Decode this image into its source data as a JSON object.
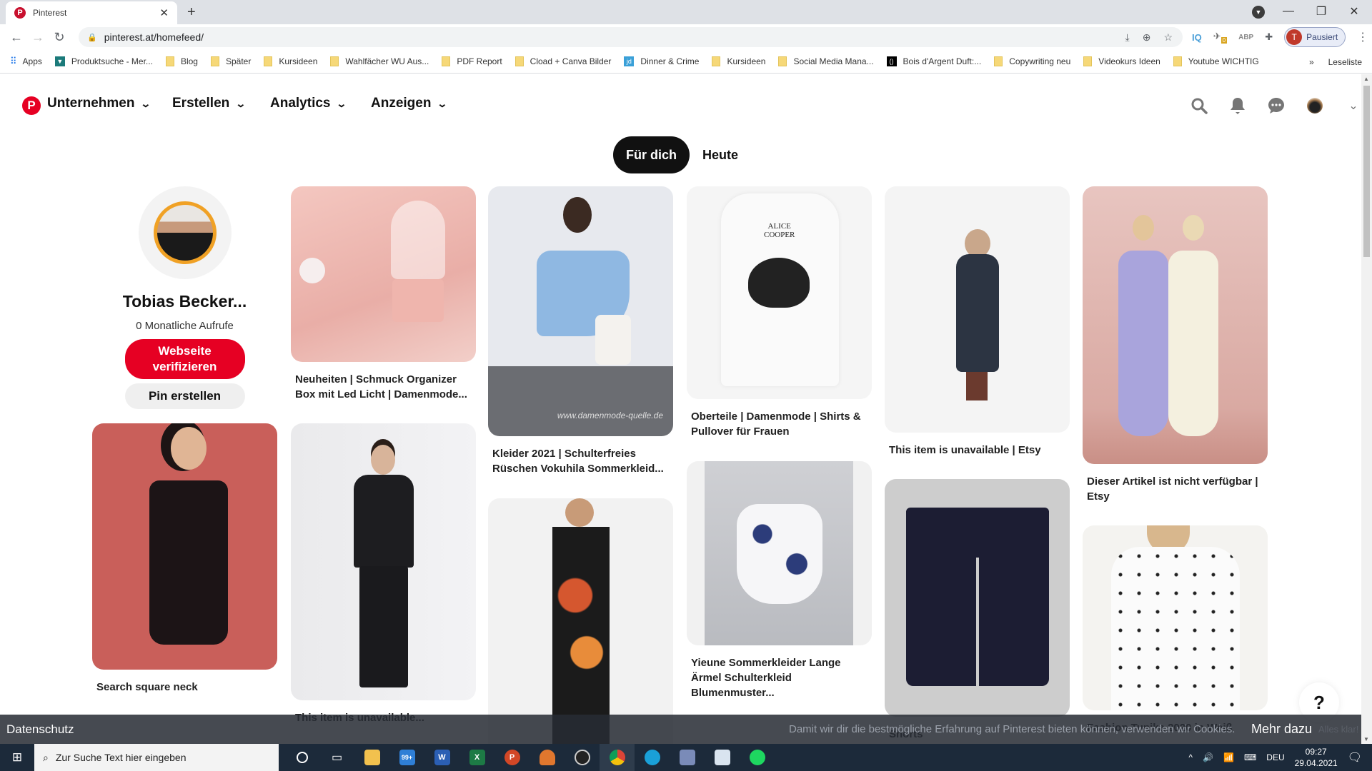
{
  "browser": {
    "tab_title": "Pinterest",
    "url": "pinterest.at/homefeed/",
    "profile_status": "Pausiert",
    "profile_initial": "T",
    "extension_badge": "0",
    "bookmarks": [
      {
        "label": "Apps",
        "icon": "apps-grid-icon"
      },
      {
        "label": "Produktsuche - Mer...",
        "icon": "shirt-icon"
      },
      {
        "label": "Blog",
        "icon": "folder-icon"
      },
      {
        "label": "Später",
        "icon": "folder-icon"
      },
      {
        "label": "Kursideen",
        "icon": "folder-icon"
      },
      {
        "label": "Wahlfächer WU Aus...",
        "icon": "folder-icon"
      },
      {
        "label": "PDF Report",
        "icon": "folder-icon"
      },
      {
        "label": "Cload + Canva Bilder",
        "icon": "folder-icon"
      },
      {
        "label": "Dinner & Crime",
        "icon": "jd-icon"
      },
      {
        "label": "Kursideen",
        "icon": "folder-icon"
      },
      {
        "label": "Social Media Mana...",
        "icon": "folder-icon"
      },
      {
        "label": "Bois d'Argent Duft:...",
        "icon": "bracket-logo-icon"
      },
      {
        "label": "Copywriting neu",
        "icon": "folder-icon"
      },
      {
        "label": "Videokurs Ideen",
        "icon": "folder-icon"
      },
      {
        "label": "Youtube WICHTIG",
        "icon": "folder-icon"
      }
    ],
    "more_bookmarks": "»",
    "reading_list": "Leseliste"
  },
  "header": {
    "menus": [
      {
        "label": "Unternehmen"
      },
      {
        "label": "Erstellen"
      },
      {
        "label": "Analytics"
      },
      {
        "label": "Anzeigen"
      }
    ],
    "icons": [
      "search-icon",
      "bell-icon",
      "chat-icon",
      "avatar",
      "chevron-down-icon"
    ]
  },
  "feed_tabs": [
    {
      "label": "Für dich",
      "active": true
    },
    {
      "label": "Heute",
      "active": false
    }
  ],
  "profile": {
    "name": "Tobias Becker...",
    "monthly_views": "0 Monatliche Aufrufe",
    "verify_button": "Webseite verifizieren",
    "create_pin_button": "Pin erstellen"
  },
  "pins": [
    {
      "caption": "Neuheiten | Schmuck Organizer Box mit Led Licht | Damenmode...",
      "image": "pink jewelry organizer lamp"
    },
    {
      "caption": "Kleider 2021 | Schulterfreies Rüschen Vokuhila Sommerkleid...",
      "image": "woman in blue ruffle dress",
      "watermark": "www.damenmode-quelle.de"
    },
    {
      "caption": "Oberteile | Damenmode | Shirts & Pullover für Frauen",
      "image": "white Alice Cooper t-shirt"
    },
    {
      "caption": "This item is unavailable | Etsy",
      "image": "woman in long quilted coat"
    },
    {
      "caption": "Dieser Artikel ist nicht verfügbar | Etsy",
      "image": "two women in long dresses"
    },
    {
      "caption": "Search square neck",
      "image": "woman in floral mini dress"
    },
    {
      "caption": "This item is unavailable...",
      "image": "man in black hoodie"
    },
    {
      "caption": "",
      "image": "woman in floral maxi dress"
    },
    {
      "caption": "Yieune Sommerkleider Lange Ärmel Schulterkleid Blumenmuster...",
      "image": "woman in off-shoulder floral dress"
    },
    {
      "caption": "Shorts",
      "image": "navy patterned shorts"
    },
    {
      "caption": "Fashion Tunika 2020 in Weiß",
      "image": "woman in white dotted tunic"
    }
  ],
  "cookie_bar": {
    "left_link": "Datenschutz",
    "message": "Damit wir dir die bestmögliche Erfahrung auf Pinterest bieten können, verwenden wir Cookies.",
    "more_link": "Mehr dazu",
    "accept": "Alles klar!"
  },
  "help_button": "?",
  "taskbar": {
    "search_placeholder": "Zur Suche Text hier eingeben",
    "mail_badge": "99+",
    "language": "DEU",
    "time": "09:27",
    "date": "29.04.2021"
  }
}
